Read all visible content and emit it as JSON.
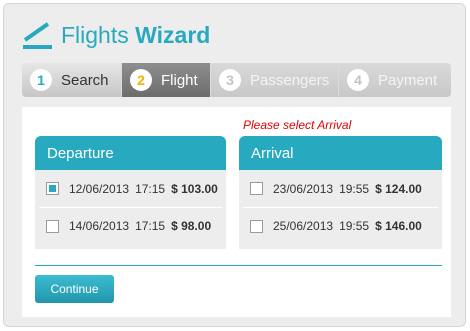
{
  "header": {
    "title_regular": "Flights",
    "title_bold": "Wizard",
    "logo_icon": "flight-logo-icon"
  },
  "steps": [
    {
      "number": "1",
      "label": "Search",
      "state": "completed"
    },
    {
      "number": "2",
      "label": "Flight",
      "state": "active"
    },
    {
      "number": "3",
      "label": "Passengers",
      "state": "disabled"
    },
    {
      "number": "4",
      "label": "Payment",
      "state": "disabled"
    }
  ],
  "error_message": "Please select Arrival",
  "departure": {
    "title": "Departure",
    "options": [
      {
        "date": "12/06/2013",
        "time": "17:15",
        "price": "$ 103.00",
        "checked": true
      },
      {
        "date": "14/06/2013",
        "time": "17:15",
        "price": "$ 98.00",
        "checked": false
      }
    ]
  },
  "arrival": {
    "title": "Arrival",
    "options": [
      {
        "date": "23/06/2013",
        "time": "19:55",
        "price": "$ 124.00",
        "checked": false
      },
      {
        "date": "25/06/2013",
        "time": "19:55",
        "price": "$ 146.00",
        "checked": false
      }
    ]
  },
  "continue_label": "Continue",
  "colors": {
    "accent": "#27a9c0",
    "error": "#e00000",
    "active_step_number": "#f0b400"
  }
}
